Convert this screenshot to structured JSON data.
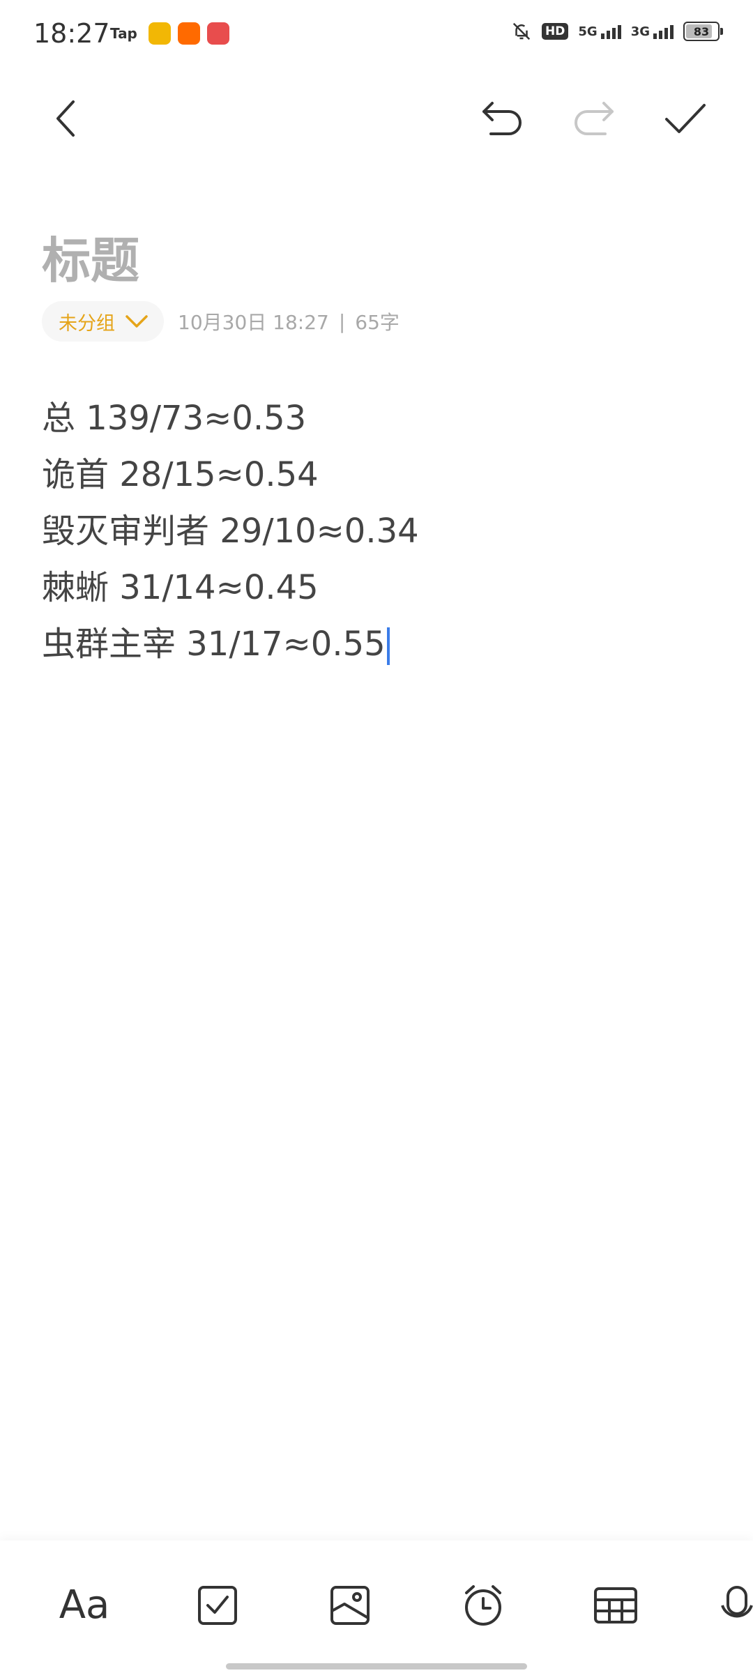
{
  "status_bar": {
    "time": "18:27",
    "tap_label": "Tap",
    "net_5g": "5G",
    "net_3g": "3G",
    "hd_label": "HD",
    "battery": "83",
    "battery_level": 0.83
  },
  "toolbar": {
    "back_icon": "chevron-left-icon",
    "undo_icon": "undo-icon",
    "redo_icon": "redo-icon",
    "done_icon": "check-icon"
  },
  "note": {
    "title_placeholder": "标题",
    "group_label": "未分组",
    "timestamp": "10月30日 18:27",
    "separator": "|",
    "word_count": "65字",
    "lines": [
      "总 139/73≈0.53",
      "诡首 28/15≈0.54",
      "毁灭审判者 29/10≈0.34",
      "棘蜥 31/14≈0.45",
      "虫群主宰 31/17≈0.55"
    ]
  },
  "bottom_toolbar": {
    "text_format_label": "Aa",
    "items": [
      "text-format",
      "checklist-icon",
      "image-icon",
      "alarm-icon",
      "table-icon",
      "voice-icon"
    ]
  },
  "colors": {
    "accent": "#e5a419",
    "cursor": "#3b7de9",
    "placeholder": "#b0b0b0"
  }
}
